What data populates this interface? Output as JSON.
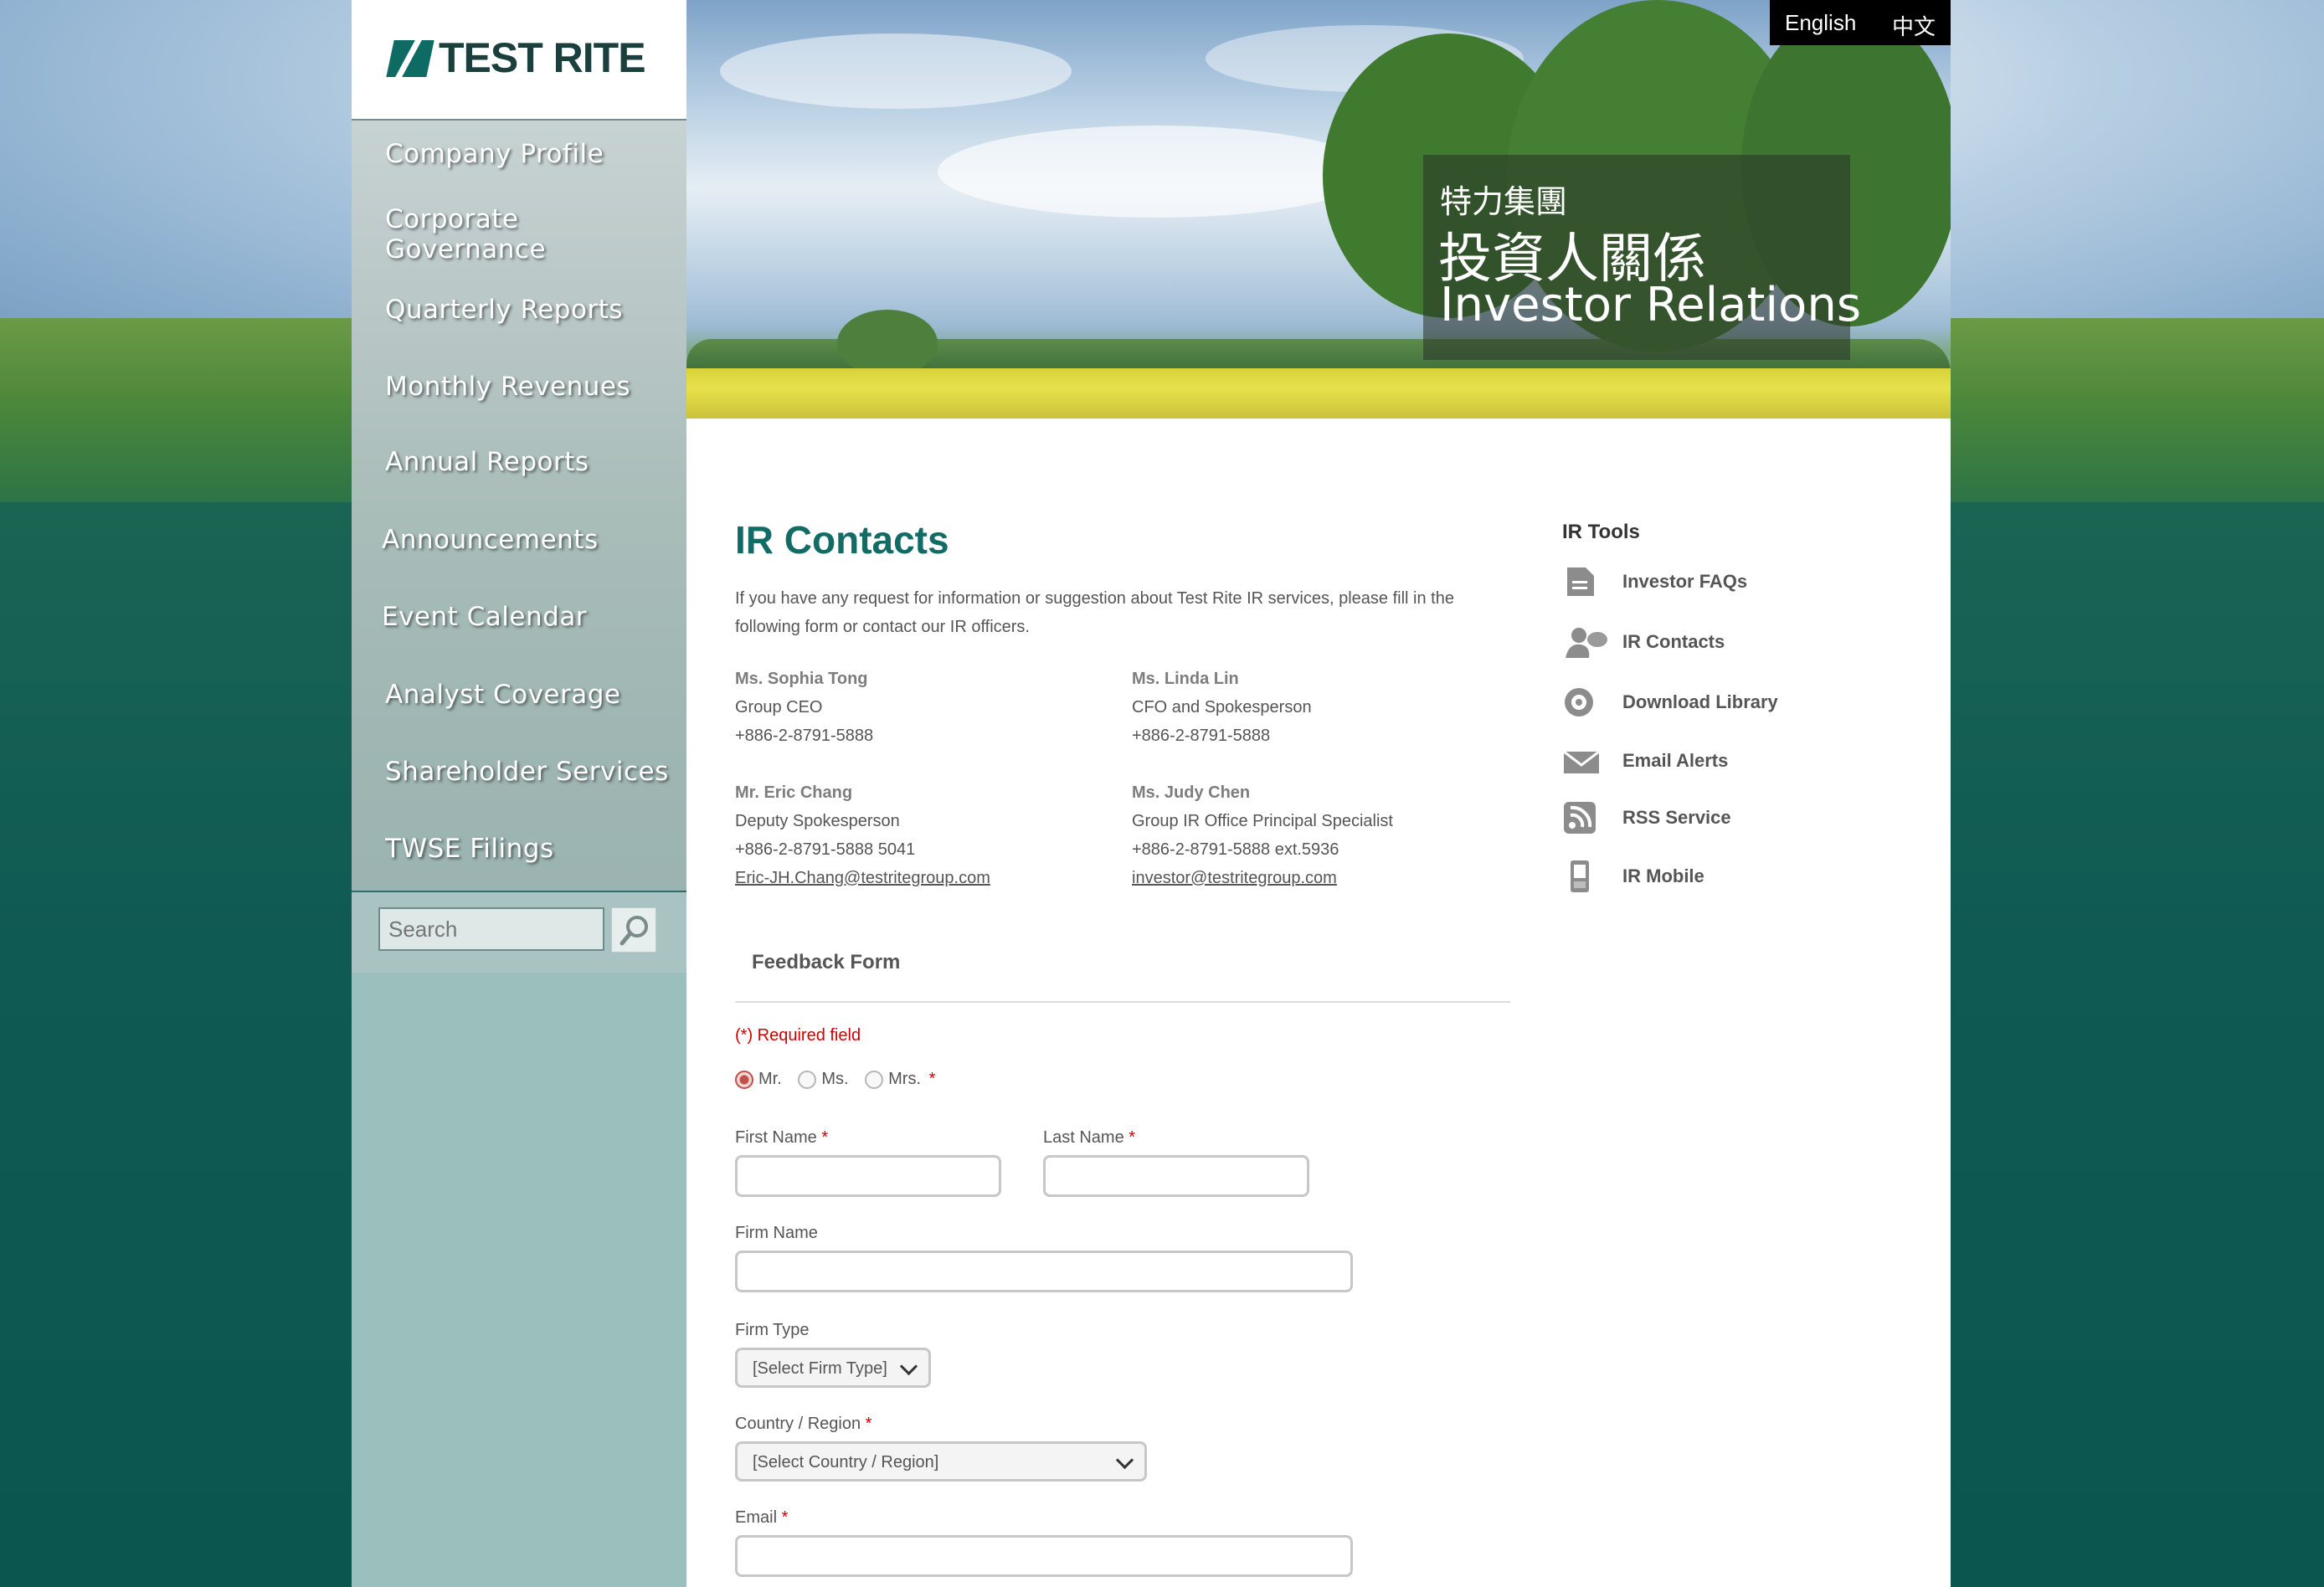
{
  "brand": {
    "logo_text": "TEST RITE"
  },
  "nav": {
    "items": [
      "Company Profile",
      "Corporate Governance",
      "Quarterly Reports",
      "Monthly Revenues",
      "Annual Reports",
      "Announcements",
      "Event Calendar",
      "Analyst Coverage",
      "Shareholder Services",
      "TWSE Filings"
    ]
  },
  "search": {
    "placeholder": "Search"
  },
  "language": {
    "english": "English",
    "chinese": "中文"
  },
  "banner": {
    "subtitle_cn": "特力集團",
    "title_cn": "投資人關係",
    "title_en": "Investor Relations"
  },
  "main": {
    "title": "IR Contacts",
    "intro_line1": "If you have any request for information or suggestion about Test Rite IR services, please fill in the",
    "intro_line2": "following form or contact our IR officers.",
    "contacts": [
      {
        "name": "Ms. Sophia Tong",
        "role": "Group CEO",
        "phone": "+886-2-8791-5888",
        "email": ""
      },
      {
        "name": "Ms. Linda Lin",
        "role": "CFO and Spokesperson",
        "phone": "+886-2-8791-5888",
        "email": ""
      },
      {
        "name": "Mr. Eric Chang",
        "role": "Deputy Spokesperson",
        "phone": "+886-2-8791-5888 5041",
        "email": "Eric-JH.Chang@testritegroup.com"
      },
      {
        "name": "Ms. Judy Chen",
        "role": "Group IR Office Principal Specialist",
        "phone": "+886-2-8791-5888 ext.5936",
        "email": "investor@testritegroup.com"
      }
    ]
  },
  "form": {
    "title": "Feedback Form",
    "required_note": "(*) Required field",
    "salutations": [
      "Mr.",
      "Ms.",
      "Mrs."
    ],
    "selected_salutation": "Mr.",
    "asterisk": "*",
    "first_name_label": "First Name",
    "last_name_label": "Last Name",
    "firm_name_label": "Firm Name",
    "firm_type_label": "Firm Type",
    "firm_type_value": "[Select Firm Type]",
    "country_label": "Country / Region",
    "country_value": "[Select Country / Region]",
    "email_label": "Email"
  },
  "tools": {
    "title": "IR Tools",
    "items": [
      {
        "label": "Investor FAQs",
        "icon": "document-icon"
      },
      {
        "label": "IR Contacts",
        "icon": "contacts-icon"
      },
      {
        "label": "Download Library",
        "icon": "download-library-icon"
      },
      {
        "label": "Email Alerts",
        "icon": "envelope-icon"
      },
      {
        "label": "RSS Service",
        "icon": "rss-icon"
      },
      {
        "label": "IR Mobile",
        "icon": "mobile-phone-icon"
      }
    ]
  },
  "colors": {
    "title_teal": "#136b66",
    "required_red": "#cc0000",
    "sidebar_bg": "#9bbfbd"
  }
}
